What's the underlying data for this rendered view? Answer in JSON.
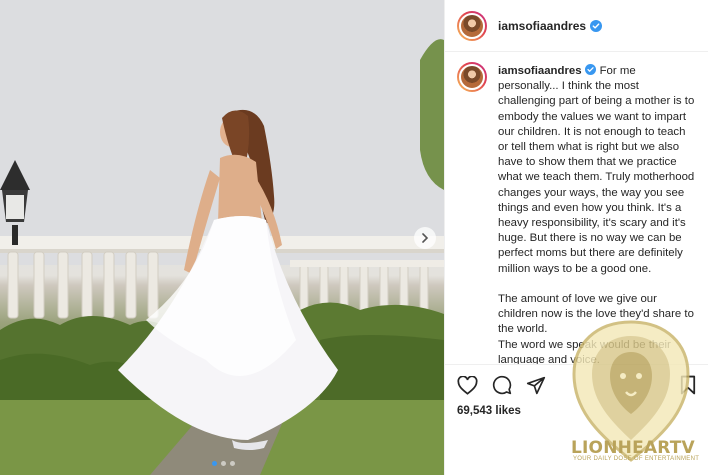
{
  "post": {
    "username": "iamsofiaandres",
    "verified": true
  },
  "caption": {
    "username": "iamsofiaandres",
    "text": "For me personally... I think the most challenging part of being a mother is to embody the values we want to impart our children. It is not enough to teach or tell them what is right but we also have to show them that we practice what we teach them. Truly motherhood changes your ways, the way you see things and even how you think. It's a heavy responsibility, it's scary and it's huge. But there is no way we can be perfect moms but there are definitely million ways to be a good one.\n\nThe amount of love we give our children now is the love they'd share to the world.\nThe word we speak would be their language and voice."
  },
  "actions": {
    "likes": "69,543 likes",
    "icons": [
      "heart-icon",
      "comment-icon",
      "share-icon",
      "bookmark-icon"
    ]
  },
  "carousel": {
    "total_slides": 3,
    "active_index": 0
  },
  "watermark": {
    "brand": "LIONHEARTV",
    "tagline": "YOUR DAILY DOSE OF ENTERTAINMENT"
  },
  "colors": {
    "verified_blue": "#3897f0",
    "watermark_gold": "#b9a35a",
    "border": "#efefef"
  }
}
